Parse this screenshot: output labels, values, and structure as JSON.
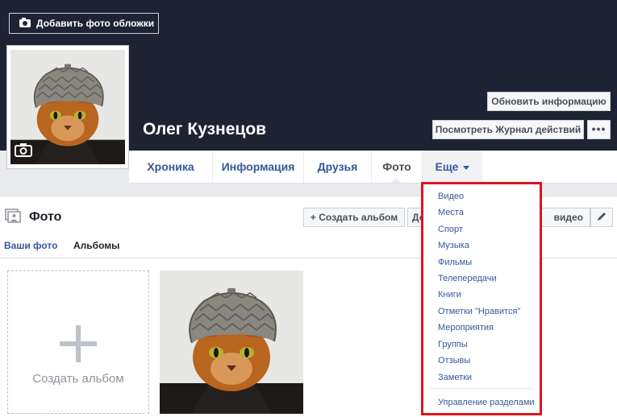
{
  "cover": {
    "add_cover_label": "Добавить фото обложки",
    "update_info_label": "Обновить информацию",
    "activity_log_label": "Посмотреть Журнал действий",
    "more_label": "•••"
  },
  "profile": {
    "name": "Олег Кузнецов"
  },
  "nav": {
    "tabs": [
      {
        "label": "Хроника"
      },
      {
        "label": "Информация"
      },
      {
        "label": "Друзья"
      },
      {
        "label": "Фото"
      },
      {
        "label": "Еще"
      }
    ]
  },
  "photos": {
    "title": "Фото",
    "create_album_label": "+ Создать альбом",
    "add_partial_label": "До",
    "video_partial_label": "видео",
    "subtabs": [
      {
        "label": "Ваши фото"
      },
      {
        "label": "Альбомы"
      }
    ],
    "create_album_card_label": "Создать альбом"
  },
  "dropdown": {
    "items": [
      {
        "label": "Видео"
      },
      {
        "label": "Места"
      },
      {
        "label": "Спорт"
      },
      {
        "label": "Музыка"
      },
      {
        "label": "Фильмы"
      },
      {
        "label": "Телепередачи"
      },
      {
        "label": "Книги"
      },
      {
        "label": "Отметки \"Нравится\""
      },
      {
        "label": "Мероприятия"
      },
      {
        "label": "Группы"
      },
      {
        "label": "Отзывы"
      },
      {
        "label": "Заметки"
      }
    ],
    "manage_label": "Управление разделами"
  },
  "colors": {
    "cover_bg": "#1d2333",
    "link": "#365899",
    "highlight_border": "#e0141e"
  }
}
